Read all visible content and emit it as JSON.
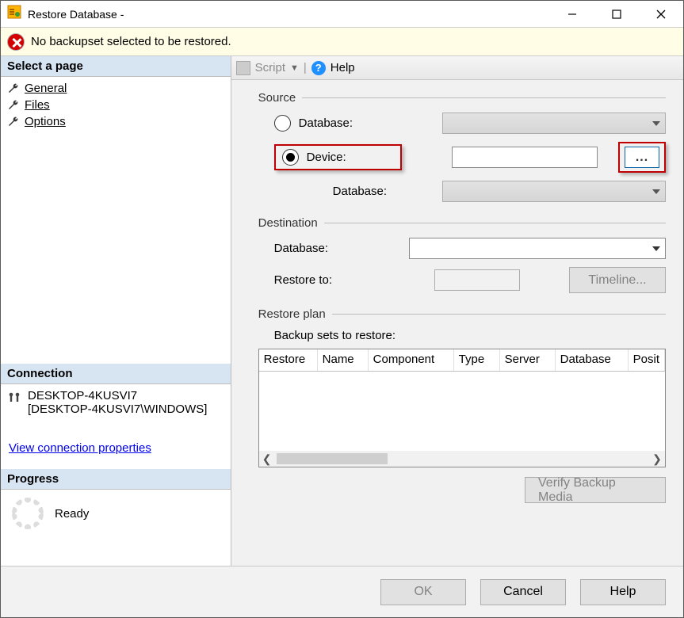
{
  "window": {
    "title": "Restore Database -"
  },
  "warning": {
    "message": "No backupset selected to be restored."
  },
  "left": {
    "select_page_header": "Select a page",
    "pages": [
      "General",
      "Files",
      "Options"
    ],
    "connection_header": "Connection",
    "server": "DESKTOP-4KUSVI7",
    "user": "[DESKTOP-4KUSVI7\\WINDOWS]",
    "view_conn_link": "View connection properties",
    "progress_header": "Progress",
    "progress_status": "Ready"
  },
  "toolbar": {
    "script": "Script",
    "help": "Help"
  },
  "source": {
    "header": "Source",
    "radio_database": "Database:",
    "radio_device": "Device:",
    "browse": "...",
    "db_label": "Database:"
  },
  "destination": {
    "header": "Destination",
    "db_label": "Database:",
    "restore_to_label": "Restore to:",
    "timeline_btn": "Timeline..."
  },
  "plan": {
    "header": "Restore plan",
    "subheader": "Backup sets to restore:",
    "columns": [
      "Restore",
      "Name",
      "Component",
      "Type",
      "Server",
      "Database",
      "Posit"
    ],
    "verify_btn": "Verify Backup Media"
  },
  "footer": {
    "ok": "OK",
    "cancel": "Cancel",
    "help": "Help"
  }
}
